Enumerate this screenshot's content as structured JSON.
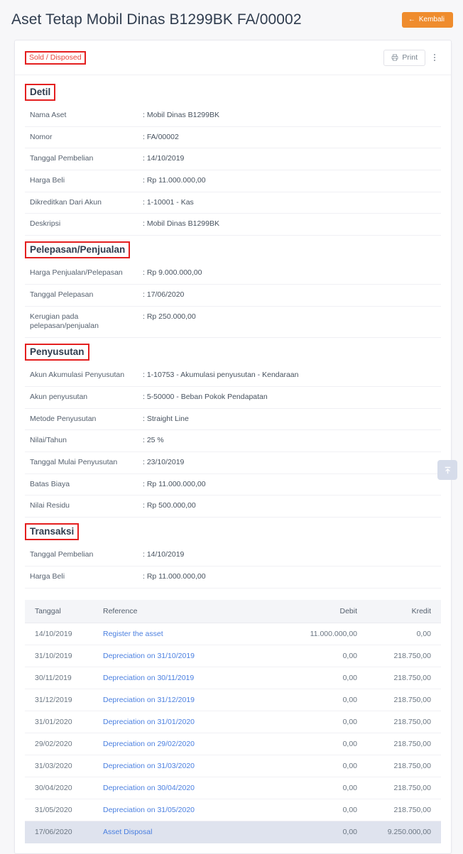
{
  "header": {
    "title": "Aset Tetap Mobil Dinas B1299BK FA/00002",
    "back_label": "Kembali",
    "back_icon": "arrow-left-icon",
    "accent_color": "#ef8c2d"
  },
  "toolbar": {
    "status_badge": "Sold / Disposed",
    "status_color": "#e8453c",
    "print_label": "Print",
    "print_icon": "printer-icon",
    "more_icon": "kebab-menu-icon"
  },
  "sections": {
    "detil": {
      "heading": "Detil",
      "rows": [
        {
          "label": "Nama Aset",
          "value": ": Mobil Dinas B1299BK"
        },
        {
          "label": "Nomor",
          "value": ": FA/00002"
        },
        {
          "label": "Tanggal Pembelian",
          "value": ": 14/10/2019"
        },
        {
          "label": "Harga Beli",
          "value": ": Rp 11.000.000,00"
        },
        {
          "label": "Dikreditkan Dari Akun",
          "value": ": 1-10001 - Kas"
        },
        {
          "label": "Deskripsi",
          "value": ": Mobil Dinas B1299BK"
        }
      ]
    },
    "pelepasan": {
      "heading": "Pelepasan/Penjualan",
      "rows": [
        {
          "label": "Harga Penjualan/Pelepasan",
          "value": ": Rp 9.000.000,00"
        },
        {
          "label": "Tanggal Pelepasan",
          "value": ": 17/06/2020"
        },
        {
          "label": "Kerugian pada pelepasan/penjualan",
          "value": ": Rp 250.000,00"
        }
      ]
    },
    "penyusutan": {
      "heading": "Penyusutan",
      "rows": [
        {
          "label": "Akun Akumulasi Penyusutan",
          "value": ": 1-10753 - Akumulasi penyusutan - Kendaraan"
        },
        {
          "label": "Akun penyusutan",
          "value": ": 5-50000 - Beban Pokok Pendapatan"
        },
        {
          "label": "Metode Penyusutan",
          "value": ": Straight Line"
        },
        {
          "label": "Nilai/Tahun",
          "value": ": 25 %"
        },
        {
          "label": "Tanggal Mulai Penyusutan",
          "value": ": 23/10/2019"
        },
        {
          "label": "Batas Biaya",
          "value": ": Rp 11.000.000,00"
        },
        {
          "label": "Nilai Residu",
          "value": ": Rp 500.000,00"
        }
      ]
    },
    "transaksi": {
      "heading": "Transaksi",
      "rows": [
        {
          "label": "Tanggal Pembelian",
          "value": ": 14/10/2019"
        },
        {
          "label": "Harga Beli",
          "value": ": Rp 11.000.000,00"
        }
      ],
      "table": {
        "columns": [
          "Tanggal",
          "Reference",
          "Debit",
          "Kredit"
        ],
        "rows": [
          {
            "date": "14/10/2019",
            "reference": "Register the asset",
            "debit": "11.000.000,00",
            "kredit": "0,00",
            "highlight": false
          },
          {
            "date": "31/10/2019",
            "reference": "Depreciation on 31/10/2019",
            "debit": "0,00",
            "kredit": "218.750,00",
            "highlight": false
          },
          {
            "date": "30/11/2019",
            "reference": "Depreciation on 30/11/2019",
            "debit": "0,00",
            "kredit": "218.750,00",
            "highlight": false
          },
          {
            "date": "31/12/2019",
            "reference": "Depreciation on 31/12/2019",
            "debit": "0,00",
            "kredit": "218.750,00",
            "highlight": false
          },
          {
            "date": "31/01/2020",
            "reference": "Depreciation on 31/01/2020",
            "debit": "0,00",
            "kredit": "218.750,00",
            "highlight": false
          },
          {
            "date": "29/02/2020",
            "reference": "Depreciation on 29/02/2020",
            "debit": "0,00",
            "kredit": "218.750,00",
            "highlight": false
          },
          {
            "date": "31/03/2020",
            "reference": "Depreciation on 31/03/2020",
            "debit": "0,00",
            "kredit": "218.750,00",
            "highlight": false
          },
          {
            "date": "30/04/2020",
            "reference": "Depreciation on 30/04/2020",
            "debit": "0,00",
            "kredit": "218.750,00",
            "highlight": false
          },
          {
            "date": "31/05/2020",
            "reference": "Depreciation on 31/05/2020",
            "debit": "0,00",
            "kredit": "218.750,00",
            "highlight": false
          },
          {
            "date": "17/06/2020",
            "reference": "Asset Disposal",
            "debit": "0,00",
            "kredit": "9.250.000,00",
            "highlight": true
          }
        ]
      }
    }
  },
  "scroll_top": {
    "icon": "scroll-to-top-icon"
  }
}
